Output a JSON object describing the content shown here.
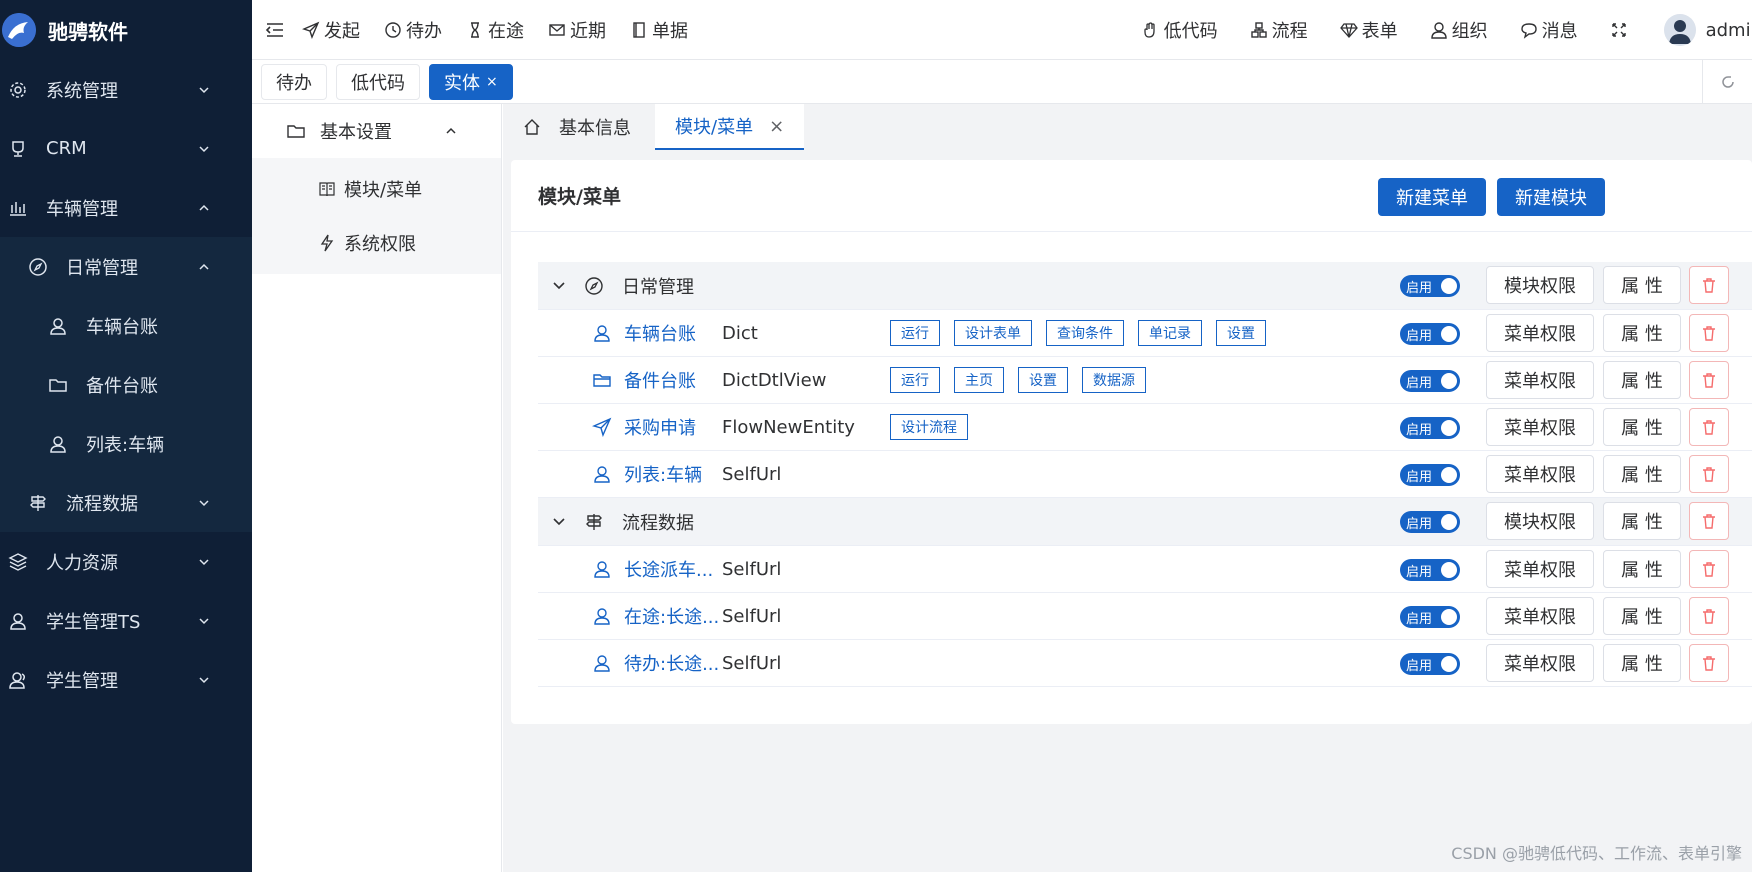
{
  "brand": {
    "title": "驰骋软件"
  },
  "sidebar": {
    "items": [
      {
        "label": "系统管理"
      },
      {
        "label": "CRM"
      },
      {
        "label": "车辆管理"
      },
      {
        "label": "日常管理"
      },
      {
        "label": "车辆台账"
      },
      {
        "label": "备件台账"
      },
      {
        "label": "列表:车辆"
      },
      {
        "label": "流程数据"
      },
      {
        "label": "人力资源"
      },
      {
        "label": "学生管理TS"
      },
      {
        "label": "学生管理"
      }
    ]
  },
  "header": {
    "links": [
      "发起",
      "待办",
      "在途",
      "近期",
      "单据"
    ],
    "right_links": [
      "低代码",
      "流程",
      "表单",
      "组织",
      "消息"
    ],
    "user": "admin"
  },
  "tabstrip": {
    "tabs": [
      "待办",
      "低代码",
      "实体"
    ],
    "close": "×"
  },
  "settings": {
    "head": "基本设置",
    "items": [
      "模块/菜单",
      "系统权限"
    ]
  },
  "subtabs": {
    "home": "基本信息",
    "active": "模块/菜单",
    "close": "×"
  },
  "card": {
    "title": "模块/菜单",
    "new_menu": "新建菜单",
    "new_module": "新建模块"
  },
  "labels": {
    "switch_on": "启用",
    "module_perm": "模块权限",
    "menu_perm": "菜单权限",
    "prop": "属 性"
  },
  "groups": [
    {
      "name": "日常管理",
      "icon": "compass-icon",
      "items": [
        {
          "name": "车辆台账",
          "type": "Dict",
          "icon": "user-icon",
          "tags": [
            "运行",
            "设计表单",
            "查询条件",
            "单记录",
            "设置"
          ]
        },
        {
          "name": "备件台账",
          "type": "DictDtlView",
          "icon": "folder-icon",
          "tags": [
            "运行",
            "主页",
            "设置",
            "数据源"
          ]
        },
        {
          "name": "采购申请",
          "type": "FlowNewEntity",
          "icon": "send-icon",
          "tags": [
            "设计流程"
          ]
        },
        {
          "name": "列表:车辆",
          "type": "SelfUrl",
          "icon": "user-icon",
          "tags": []
        }
      ]
    },
    {
      "name": "流程数据",
      "icon": "signpost-icon",
      "items": [
        {
          "name": "长途派车...",
          "type": "SelfUrl",
          "icon": "user-icon",
          "tags": []
        },
        {
          "name": "在途:长途...",
          "type": "SelfUrl",
          "icon": "user-icon",
          "tags": []
        },
        {
          "name": "待办:长途...",
          "type": "SelfUrl",
          "icon": "user-icon",
          "tags": []
        }
      ]
    }
  ],
  "watermark": "CSDN @驰骋低代码、工作流、表单引擎"
}
